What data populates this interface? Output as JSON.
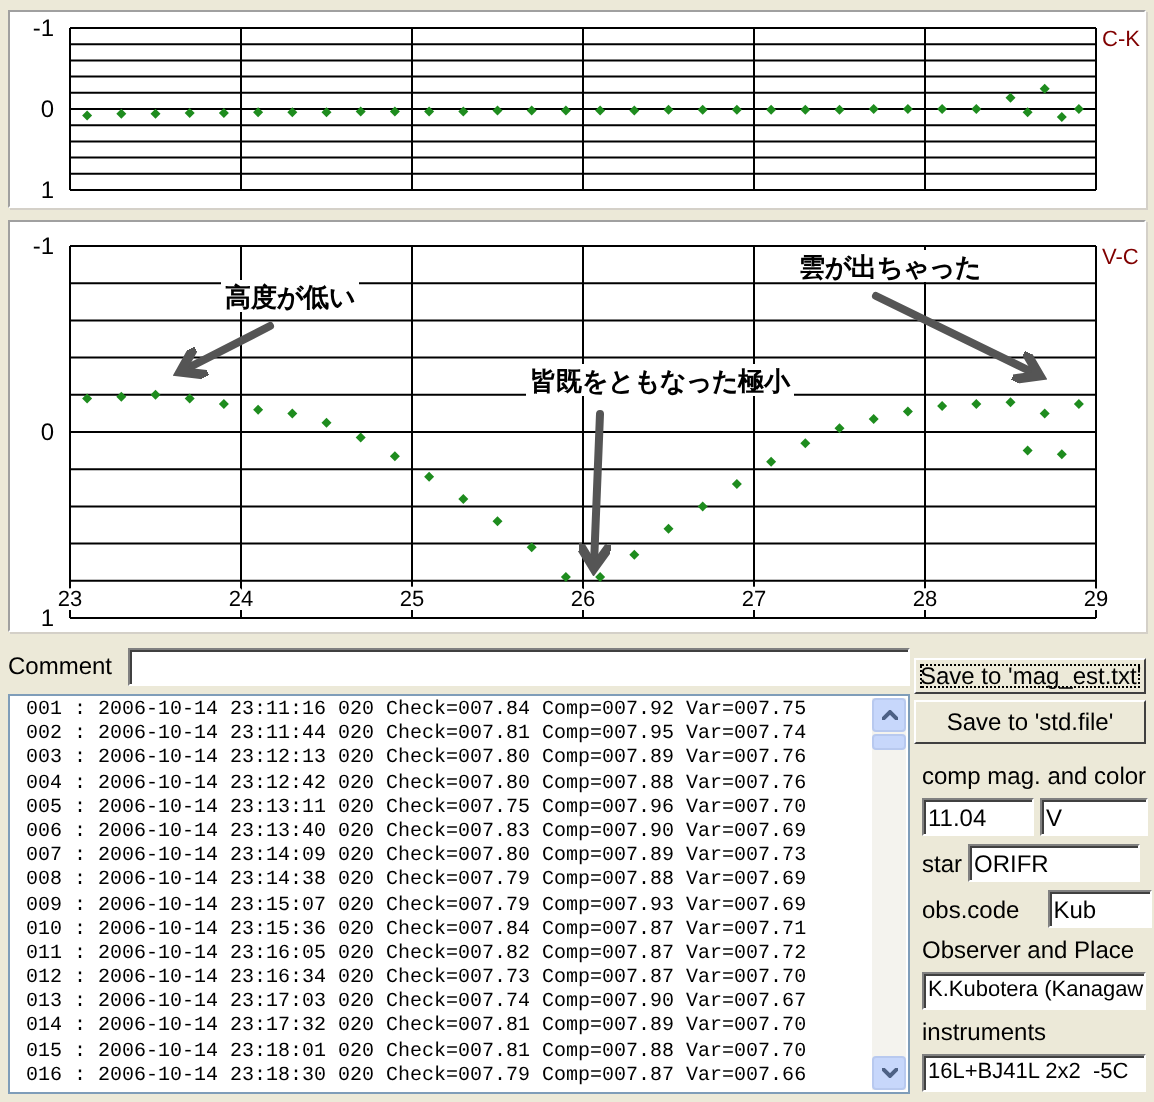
{
  "charts": [
    {
      "chart_data": {
        "type": "scatter",
        "x": [
          23.1,
          23.3,
          23.5,
          23.7,
          23.9,
          24.1,
          24.3,
          24.5,
          24.7,
          24.9,
          25.1,
          25.3,
          25.5,
          25.7,
          25.9,
          26.1,
          26.3,
          26.5,
          26.7,
          26.9,
          27.1,
          27.3,
          27.5,
          27.7,
          27.9,
          28.1,
          28.3,
          28.5,
          28.6,
          28.7,
          28.8,
          28.9
        ],
        "series": [
          {
            "name": "C-K",
            "color": "#1e8c1e",
            "values": [
              0.08,
              0.06,
              0.06,
              0.05,
              0.05,
              0.04,
              0.04,
              0.04,
              0.03,
              0.03,
              0.03,
              0.03,
              0.02,
              0.02,
              0.02,
              0.02,
              0.02,
              0.01,
              0.01,
              0.01,
              0.01,
              0.01,
              0.01,
              0.0,
              0.0,
              0.0,
              0.0,
              -0.14,
              0.04,
              -0.25,
              0.1,
              0.0
            ]
          }
        ],
        "xlim": [
          23,
          29
        ],
        "ylim": [
          1,
          -1
        ],
        "yticks": [
          -1,
          0,
          1
        ],
        "grid": true
      }
    },
    {
      "chart_data": {
        "type": "scatter",
        "x": [
          23.1,
          23.3,
          23.5,
          23.7,
          23.9,
          24.1,
          24.3,
          24.5,
          24.7,
          24.9,
          25.1,
          25.3,
          25.5,
          25.7,
          25.9,
          26.1,
          26.3,
          26.5,
          26.7,
          26.9,
          27.1,
          27.3,
          27.5,
          27.7,
          27.9,
          28.1,
          28.3,
          28.5,
          28.6,
          28.7,
          28.8,
          28.9
        ],
        "series": [
          {
            "name": "V-C",
            "color": "#1e8c1e",
            "values": [
              -0.18,
              -0.19,
              -0.2,
              -0.18,
              -0.15,
              -0.12,
              -0.1,
              -0.05,
              0.03,
              0.13,
              0.24,
              0.36,
              0.48,
              0.62,
              0.78,
              0.78,
              0.66,
              0.52,
              0.4,
              0.28,
              0.16,
              0.06,
              -0.02,
              -0.07,
              -0.11,
              -0.14,
              -0.15,
              -0.16,
              0.1,
              -0.1,
              0.12,
              -0.15
            ]
          }
        ],
        "xlim": [
          23,
          29
        ],
        "ylim": [
          1,
          -1
        ],
        "xticks": [
          23,
          24,
          25,
          26,
          27,
          28,
          29
        ],
        "yticks": [
          -1,
          0,
          1
        ],
        "grid": true,
        "annotations": [
          "高度が低い",
          "皆既をともなった極小",
          "雲が出ちゃった"
        ]
      }
    }
  ],
  "comment": {
    "label": "Comment"
  },
  "log_lines": [
    "001 : 2006-10-14 23:11:16 020 Check=007.84 Comp=007.92 Var=007.75",
    "002 : 2006-10-14 23:11:44 020 Check=007.81 Comp=007.95 Var=007.74",
    "003 : 2006-10-14 23:12:13 020 Check=007.80 Comp=007.89 Var=007.76",
    "004 : 2006-10-14 23:12:42 020 Check=007.80 Comp=007.88 Var=007.76",
    "005 : 2006-10-14 23:13:11 020 Check=007.75 Comp=007.96 Var=007.70",
    "006 : 2006-10-14 23:13:40 020 Check=007.83 Comp=007.90 Var=007.69",
    "007 : 2006-10-14 23:14:09 020 Check=007.80 Comp=007.89 Var=007.73",
    "008 : 2006-10-14 23:14:38 020 Check=007.79 Comp=007.88 Var=007.69",
    "009 : 2006-10-14 23:15:07 020 Check=007.79 Comp=007.93 Var=007.69",
    "010 : 2006-10-14 23:15:36 020 Check=007.84 Comp=007.87 Var=007.71",
    "011 : 2006-10-14 23:16:05 020 Check=007.82 Comp=007.87 Var=007.72",
    "012 : 2006-10-14 23:16:34 020 Check=007.73 Comp=007.87 Var=007.70",
    "013 : 2006-10-14 23:17:03 020 Check=007.74 Comp=007.90 Var=007.67",
    "014 : 2006-10-14 23:17:32 020 Check=007.81 Comp=007.89 Var=007.70",
    "015 : 2006-10-14 23:18:01 020 Check=007.81 Comp=007.88 Var=007.70",
    "016 : 2006-10-14 23:18:30 020 Check=007.79 Comp=007.87 Var=007.66"
  ],
  "buttons": [
    {
      "label": "Save to 'mag_est.txt'",
      "focused": true
    },
    {
      "label": "Save to 'std.file'",
      "focused": false
    }
  ],
  "settings": {
    "comp_label": "comp mag. and color",
    "comp_mag": "11.04",
    "band": "V",
    "star_label": "star",
    "star": "ORIFR",
    "obs_code_label": "obs.code",
    "obs_code": "Kub",
    "observer_label": "Observer and Place",
    "observer": "K.Kubotera (Kanagaw",
    "instruments_label": "instruments",
    "instruments": "16L+BJ41L 2x2  -5C"
  }
}
